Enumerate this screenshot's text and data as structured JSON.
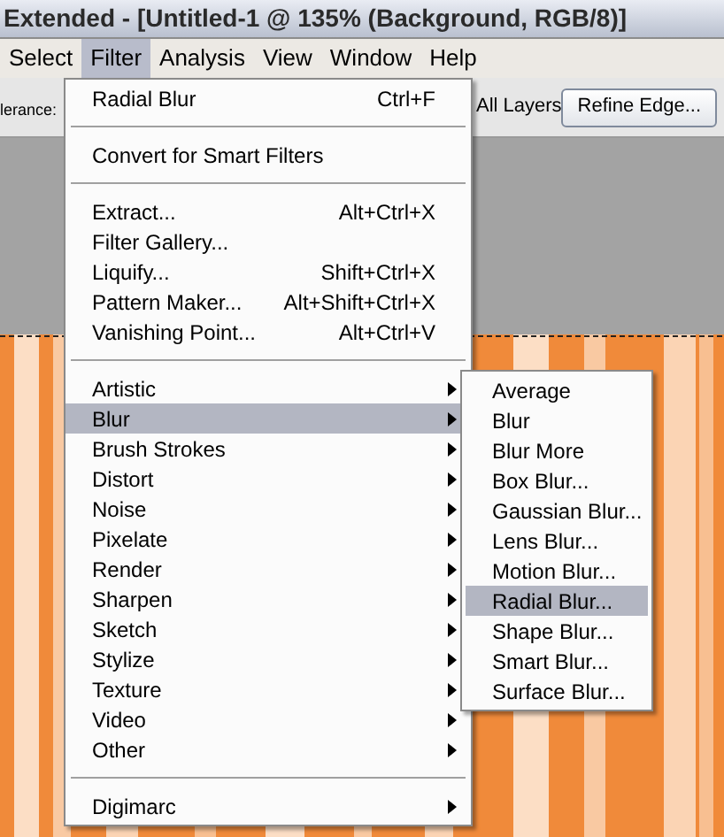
{
  "window": {
    "title": "Extended - [Untitled-1 @ 135% (Background, RGB/8)]"
  },
  "menu_bar": [
    {
      "label": "Select",
      "selected": false
    },
    {
      "label": "Filter",
      "selected": true
    },
    {
      "label": "Analysis",
      "selected": false
    },
    {
      "label": "View",
      "selected": false
    },
    {
      "label": "Window",
      "selected": false
    },
    {
      "label": "Help",
      "selected": false
    }
  ],
  "options_bar": {
    "tolerance_label": "lerance:",
    "layers_label": "All Layers",
    "refine_button": "Refine Edge..."
  },
  "filter_menu": [
    {
      "kind": "item",
      "label": "Radial Blur",
      "shortcut": "Ctrl+F",
      "submenu": false,
      "selected": false
    },
    {
      "kind": "separator"
    },
    {
      "kind": "item",
      "label": "Convert for Smart Filters",
      "submenu": false,
      "selected": false
    },
    {
      "kind": "separator"
    },
    {
      "kind": "item",
      "label": "Extract...",
      "shortcut": "Alt+Ctrl+X",
      "submenu": false,
      "selected": false
    },
    {
      "kind": "item",
      "label": "Filter Gallery...",
      "submenu": false,
      "selected": false
    },
    {
      "kind": "item",
      "label": "Liquify...",
      "shortcut": "Shift+Ctrl+X",
      "submenu": false,
      "selected": false
    },
    {
      "kind": "item",
      "label": "Pattern Maker...",
      "shortcut": "Alt+Shift+Ctrl+X",
      "submenu": false,
      "selected": false
    },
    {
      "kind": "item",
      "label": "Vanishing Point...",
      "shortcut": "Alt+Ctrl+V",
      "submenu": false,
      "selected": false
    },
    {
      "kind": "separator"
    },
    {
      "kind": "item",
      "label": "Artistic",
      "submenu": true,
      "selected": false
    },
    {
      "kind": "item",
      "label": "Blur",
      "submenu": true,
      "selected": true
    },
    {
      "kind": "item",
      "label": "Brush Strokes",
      "submenu": true,
      "selected": false
    },
    {
      "kind": "item",
      "label": "Distort",
      "submenu": true,
      "selected": false
    },
    {
      "kind": "item",
      "label": "Noise",
      "submenu": true,
      "selected": false
    },
    {
      "kind": "item",
      "label": "Pixelate",
      "submenu": true,
      "selected": false
    },
    {
      "kind": "item",
      "label": "Render",
      "submenu": true,
      "selected": false
    },
    {
      "kind": "item",
      "label": "Sharpen",
      "submenu": true,
      "selected": false
    },
    {
      "kind": "item",
      "label": "Sketch",
      "submenu": true,
      "selected": false
    },
    {
      "kind": "item",
      "label": "Stylize",
      "submenu": true,
      "selected": false
    },
    {
      "kind": "item",
      "label": "Texture",
      "submenu": true,
      "selected": false
    },
    {
      "kind": "item",
      "label": "Video",
      "submenu": true,
      "selected": false
    },
    {
      "kind": "item",
      "label": "Other",
      "submenu": true,
      "selected": false
    },
    {
      "kind": "separator"
    },
    {
      "kind": "item",
      "label": "Digimarc",
      "submenu": true,
      "selected": false
    }
  ],
  "blur_submenu": [
    {
      "label": "Average",
      "selected": false
    },
    {
      "label": "Blur",
      "selected": false
    },
    {
      "label": "Blur More",
      "selected": false
    },
    {
      "label": "Box Blur...",
      "selected": false
    },
    {
      "label": "Gaussian Blur...",
      "selected": false
    },
    {
      "label": "Lens Blur...",
      "selected": false
    },
    {
      "label": "Motion Blur...",
      "selected": false
    },
    {
      "label": "Radial Blur...",
      "selected": true
    },
    {
      "label": "Shape Blur...",
      "selected": false
    },
    {
      "label": "Smart Blur...",
      "selected": false
    },
    {
      "label": "Surface Blur...",
      "selected": false
    }
  ]
}
